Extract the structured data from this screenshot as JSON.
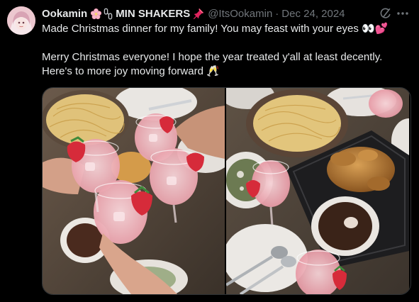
{
  "tweet": {
    "display_name": "Ookamin",
    "name_suffix": "MIN SHAKERS",
    "handle": "@ItsOokamin",
    "separator": "·",
    "date": "Dec 24, 2024",
    "text_line1": "Made Christmas dinner for my family! You may feast with your eyes 👀💕",
    "text_line2": "Merry Christmas everyone! I hope the year treated y'all at least decently.",
    "text_line3": "Here's to more joy moving forward 🥂",
    "name_emojis": [
      "cherry-blossom-icon",
      "chain-link-icon"
    ],
    "pin_icon": "pushpin-icon"
  },
  "media": {
    "photos": [
      {
        "name": "photo-toast-left"
      },
      {
        "name": "photo-table-right"
      }
    ]
  },
  "colors": {
    "background": "#000000",
    "text": "#e7e9ea",
    "muted": "#71767b",
    "border": "#2f3336"
  }
}
